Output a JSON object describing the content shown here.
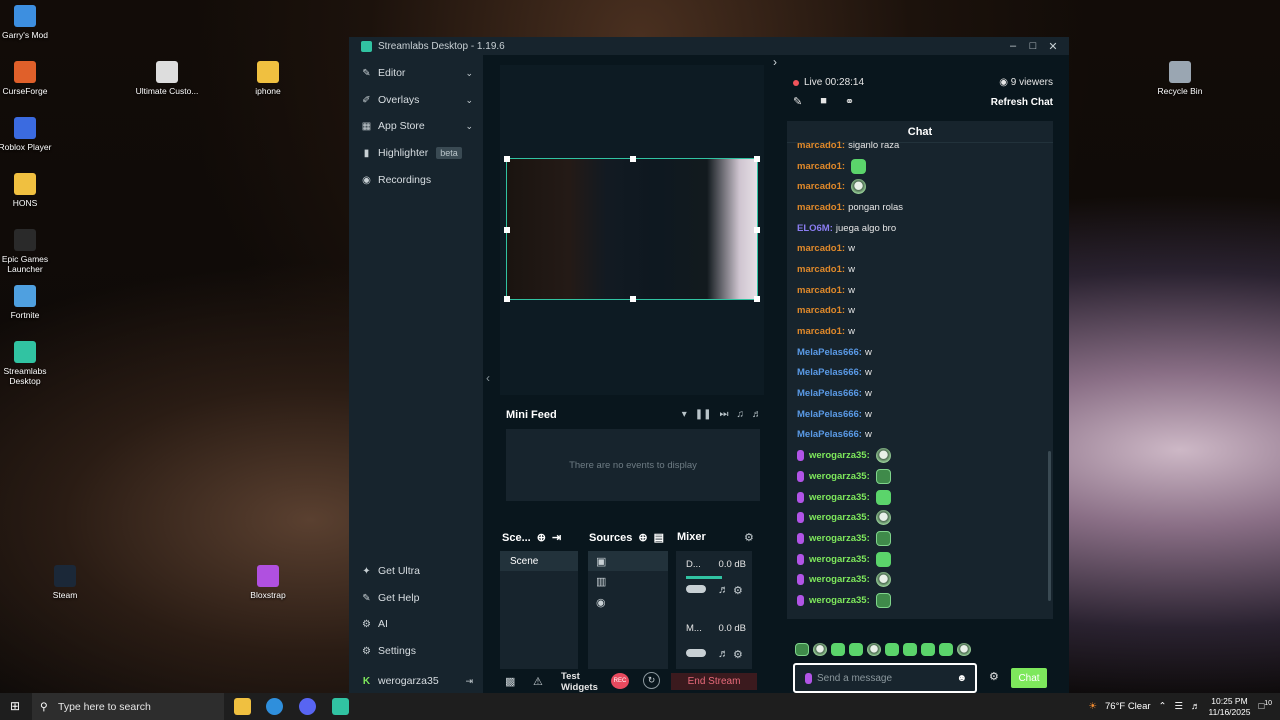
{
  "desktop": {
    "icons": [
      {
        "label": "Garry's Mod",
        "color": "#3d8fe0"
      },
      {
        "label": "CurseForge",
        "color": "#e0602a"
      },
      {
        "label": "Roblox Player",
        "color": "#3b6be0"
      },
      {
        "label": "HONS",
        "color": "#f0c040"
      },
      {
        "label": "Epic Games Launcher",
        "color": "#2a2a2a"
      },
      {
        "label": "Fortnite",
        "color": "#4fa0e0"
      },
      {
        "label": "Streamlabs Desktop",
        "color": "#31c3a2"
      },
      {
        "label": "Ultimate Custo...",
        "color": "#dddddd"
      },
      {
        "label": "iphone",
        "color": "#f0c040"
      },
      {
        "label": "Recycle Bin",
        "color": "#9aa6b2"
      },
      {
        "label": "Steam",
        "color": "#1b2838"
      },
      {
        "label": "Bloxstrap",
        "color": "#b050e0"
      }
    ]
  },
  "window": {
    "title": "Streamlabs Desktop - 1.19.6"
  },
  "sidebar": {
    "items": [
      {
        "label": "Editor",
        "icon": "pencil-icon",
        "chevron": true
      },
      {
        "label": "Overlays",
        "icon": "brush-icon",
        "chevron": true
      },
      {
        "label": "App Store",
        "icon": "store-icon",
        "chevron": true
      },
      {
        "label": "Highlighter",
        "icon": "highlighter-icon",
        "badge": "beta"
      },
      {
        "label": "Recordings",
        "icon": "record-icon"
      }
    ],
    "bottom": [
      {
        "label": "Get Ultra",
        "icon": "ultra-icon"
      },
      {
        "label": "Get Help",
        "icon": "help-icon"
      },
      {
        "label": "AI",
        "icon": "ai-icon"
      },
      {
        "label": "Settings",
        "icon": "gear-icon"
      }
    ],
    "user": "werogarza35"
  },
  "minifeed": {
    "title": "Mini Feed",
    "empty": "There are no events to display"
  },
  "dock": {
    "scenes_title": "Sce...",
    "sources_title": "Sources",
    "mixer_title": "Mixer",
    "scene_item": "Scene",
    "mixer": [
      {
        "name": "D...",
        "level": "0.0 dB"
      },
      {
        "name": "M...",
        "level": "0.0 dB"
      }
    ]
  },
  "bottombar": {
    "test_widgets": "Test Widgets",
    "rec": "REC",
    "end_stream": "End Stream"
  },
  "chat": {
    "live_label": "Live 00:28:14",
    "viewers": "9 viewers",
    "refresh": "Refresh Chat",
    "header": "Chat",
    "messages": [
      {
        "user": "marcado1",
        "color": "#e0892a",
        "text": "siganlo raza"
      },
      {
        "user": "marcado1",
        "color": "#e0892a",
        "emote": "green"
      },
      {
        "user": "marcado1",
        "color": "#e0892a",
        "emote": "face"
      },
      {
        "user": "marcado1",
        "color": "#e0892a",
        "text": "pongan rolas"
      },
      {
        "user": "ELO6M",
        "color": "#8a7cf0",
        "text": "juega algo bro"
      },
      {
        "user": "marcado1",
        "color": "#e0892a",
        "text": "w"
      },
      {
        "user": "marcado1",
        "color": "#e0892a",
        "text": "w"
      },
      {
        "user": "marcado1",
        "color": "#e0892a",
        "text": "w"
      },
      {
        "user": "marcado1",
        "color": "#e0892a",
        "text": "w"
      },
      {
        "user": "marcado1",
        "color": "#e0892a",
        "text": "w"
      },
      {
        "user": "MelaPelas666",
        "color": "#5a9ae6",
        "text": "w"
      },
      {
        "user": "MelaPelas666",
        "color": "#5a9ae6",
        "text": "w"
      },
      {
        "user": "MelaPelas666",
        "color": "#5a9ae6",
        "text": "w"
      },
      {
        "user": "MelaPelas666",
        "color": "#5a9ae6",
        "text": "w"
      },
      {
        "user": "MelaPelas666",
        "color": "#5a9ae6",
        "text": "w"
      },
      {
        "user": "werogarza35",
        "color": "#7ee85c",
        "emote": "face",
        "mic": true
      },
      {
        "user": "werogarza35",
        "color": "#7ee85c",
        "emote": "box",
        "mic": true
      },
      {
        "user": "werogarza35",
        "color": "#7ee85c",
        "emote": "green",
        "mic": true
      },
      {
        "user": "werogarza35",
        "color": "#7ee85c",
        "emote": "face",
        "mic": true
      },
      {
        "user": "werogarza35",
        "color": "#7ee85c",
        "emote": "box",
        "mic": true
      },
      {
        "user": "werogarza35",
        "color": "#7ee85c",
        "emote": "green",
        "mic": true
      },
      {
        "user": "werogarza35",
        "color": "#7ee85c",
        "emote": "face",
        "mic": true
      },
      {
        "user": "werogarza35",
        "color": "#7ee85c",
        "emote": "box",
        "mic": true
      }
    ],
    "placeholder": "Send a message",
    "send": "Chat"
  },
  "taskbar": {
    "search_placeholder": "Type here to search",
    "weather": "76°F  Clear",
    "time": "10:25 PM",
    "date": "11/16/2025",
    "notifications": "10"
  }
}
